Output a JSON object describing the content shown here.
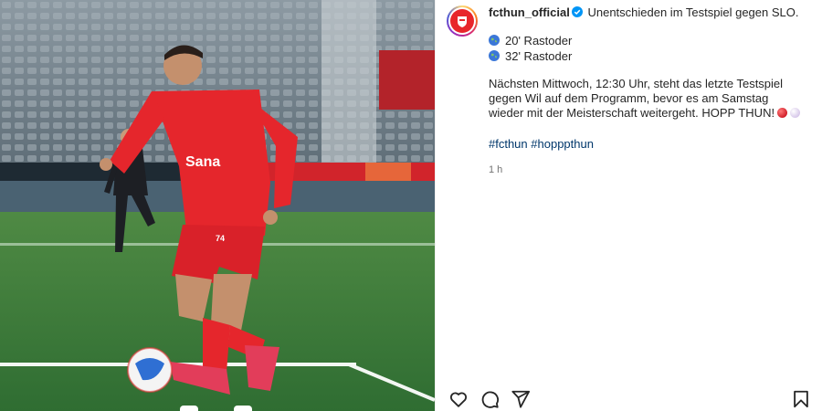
{
  "post": {
    "username": "fcthun_official",
    "caption_intro": "Unentschieden im Testspiel gegen SLO.",
    "goals": [
      "20' Rastoder",
      "32' Rastoder"
    ],
    "body_text": "Nächsten Mittwoch, 12:30 Uhr, steht das letzte Testspiel gegen Wil auf dem Programm, bevor es am Samstag wieder mit der Meisterschaft weitergeht. HOPP THUN!",
    "hashtags": [
      "#fcthun",
      "#hopppthun"
    ],
    "time_ago": "1 h",
    "verified": true,
    "emojis": [
      "red-circle",
      "moon"
    ]
  },
  "photo": {
    "jersey_sponsor": "Sana",
    "player_number": "74",
    "carousel_slides_visible": 2
  },
  "actions": {
    "icons": [
      "heart-icon",
      "comment-icon",
      "share-icon",
      "save-icon"
    ]
  },
  "colors": {
    "link": "#00376b",
    "verified": "#0095f6",
    "brand_red": "#e8262b",
    "muted": "#737373"
  }
}
